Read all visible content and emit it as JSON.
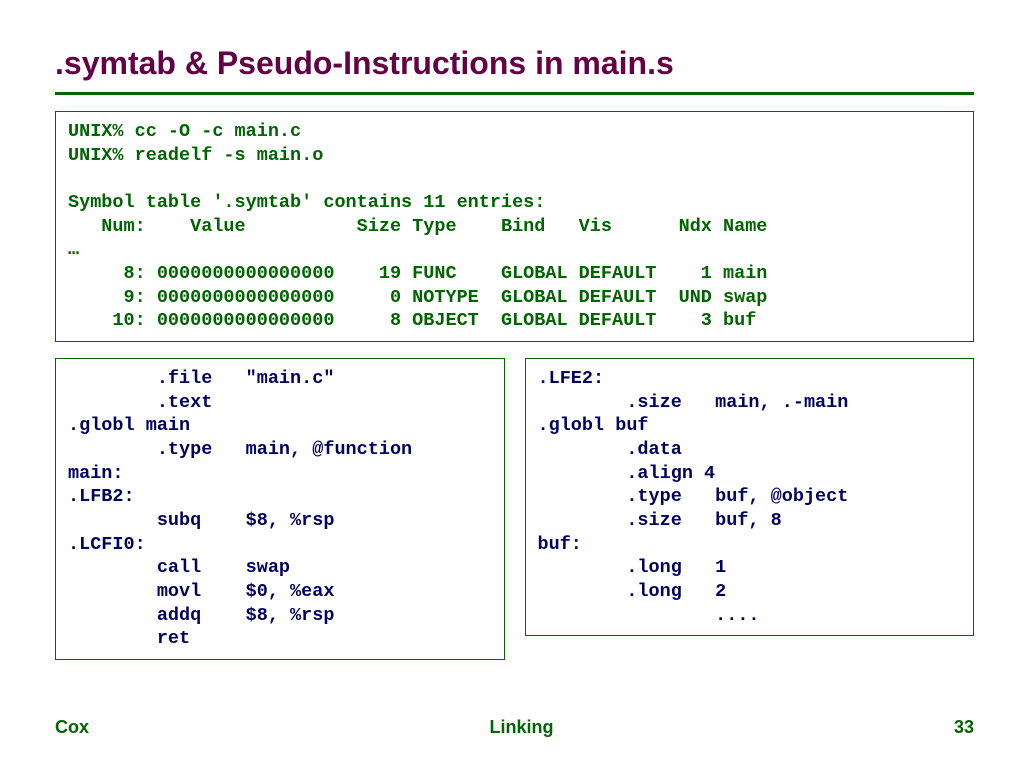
{
  "title": ".symtab & Pseudo-Instructions in main.s",
  "topbox": {
    "lines": [
      "UNIX% cc -O -c main.c",
      "UNIX% readelf -s main.o",
      "",
      "Symbol table '.symtab' contains 11 entries:",
      "   Num:    Value          Size Type    Bind   Vis      Ndx Name",
      "…",
      "     8: 0000000000000000    19 FUNC    GLOBAL DEFAULT    1 main",
      "     9: 0000000000000000     0 NOTYPE  GLOBAL DEFAULT  UND swap",
      "    10: 0000000000000000     8 OBJECT  GLOBAL DEFAULT    3 buf"
    ]
  },
  "leftbox": {
    "lines": [
      "        .file   \"main.c\"",
      "        .text",
      ".globl main",
      "        .type   main, @function",
      "main:",
      ".LFB2:",
      "        subq    $8, %rsp",
      ".LCFI0:",
      "        call    swap",
      "        movl    $0, %eax",
      "        addq    $8, %rsp",
      "        ret"
    ]
  },
  "rightbox": {
    "lines": [
      ".LFE2:",
      "        .size   main, .-main",
      ".globl buf",
      "        .data",
      "        .align 4",
      "        .type   buf, @object",
      "        .size   buf, 8",
      "buf:",
      "        .long   1",
      "        .long   2",
      "                ...."
    ]
  },
  "footer": {
    "left": "Cox",
    "center": "Linking",
    "right": "33"
  }
}
